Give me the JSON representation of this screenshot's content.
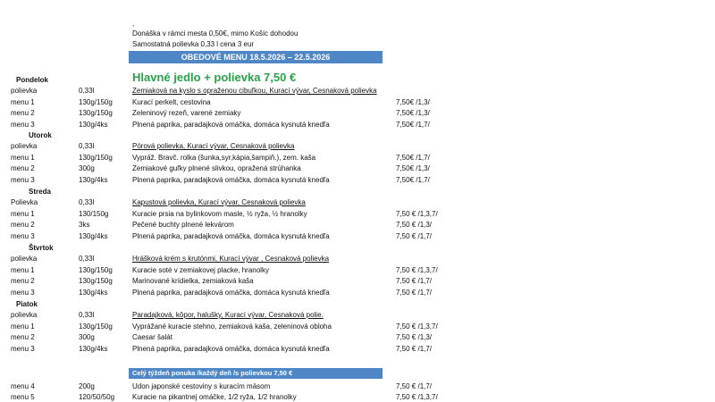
{
  "header": {
    "mark": ",",
    "delivery": "Donáška v rámci mesta 0,50€, mimo Košíc dohodou",
    "soup_note": "Samostatná polievka  0,33 l cena 3 eur",
    "banner": "OBEDOVÉ MENU 18.5.2026 – 22.5.2026",
    "main_title": "Hlavné  jedlo + polievka  7,50 €"
  },
  "days": [
    {
      "name": "Pondelok",
      "rows": [
        {
          "label": "polievka",
          "qty": "0,33l",
          "desc": "Zemiaková na kyslo s opraženou cibuľkou, Kurací vývar,  Cesnaková polievka",
          "price": ""
        },
        {
          "label": " menu 1",
          "qty": "130g/150g",
          "desc": "Kurací perkelt, cestovina",
          "price": "7,50€  /1,3/"
        },
        {
          "label": " menu 2",
          "qty": "130g/150g",
          "desc": "Zeleninový rezeň, varené zemiaky",
          "price": "7,50€  /1,3/"
        },
        {
          "label": " menu 3",
          "qty": "130g/4ks",
          "desc": "Plnená paprika, paradajková omáčka, domáca kysnutá knedľa",
          "price": "7,50€  /1,7/"
        }
      ]
    },
    {
      "name": "Utorok",
      "rows": [
        {
          "label": "polievka",
          "qty": "0,33l",
          "desc": "Pórová polievka,  Kurací vývar,  Cesnaková polievka",
          "price": ""
        },
        {
          "label": "menu 1",
          "qty": "130g/150g",
          "desc": "Vypráž. Bravč. rolka (šunka,syr,kápia,šampiň.), zem. kaša",
          "price": "7,50€  /1,7/"
        },
        {
          "label": "menu 2",
          "qty": "300g",
          "desc": "Zemiakové guľky plnené slivkou, opražená strúhanka",
          "price": "7,50€  /1,3/"
        },
        {
          "label": " menu 3",
          "qty": "130g/4ks",
          "desc": "Plnená paprika, paradajková omáčka, domáca kysnutá knedľa",
          "price": "7,50€  /1,7/"
        }
      ]
    },
    {
      "name": "Streda",
      "rows": [
        {
          "label": "Polievka",
          "qty": "0,33l",
          "desc": "Kapustová  polievka,  Kurací vývar,  Cesnaková polievka",
          "price": ""
        },
        {
          "label": "menu 1",
          "qty": "130/150g",
          "desc": "Kuracie prsia na bylinkovom masle, ½ ryža, ½ hranolky",
          "price": "7,50 €  /1,3,7/"
        },
        {
          "label": "menu 2",
          "qty": "3ks",
          "desc": "Pečené buchty plnené lekvárom",
          "price": "7,50 €  /1,3/"
        },
        {
          "label": "menu 3",
          "qty": "130g/4ks",
          "desc": "Plnená paprika, paradajková omáčka, domáca kysnutá knedľa",
          "price": "7,50 €  /1,7/"
        }
      ]
    },
    {
      "name": "Štvrtok",
      "rows": [
        {
          "label": "polievka",
          "qty": "0,33l",
          "desc": "Hrášková krém s krutónmi, Kurací vývar , Cesnaková polievka",
          "price": ""
        },
        {
          "label": "menu 1",
          "qty": "130g/150g",
          "desc": "Kuracie soté v zemiakovej placke, hranolky",
          "price": "7,50 €  /1,3,7/"
        },
        {
          "label": "menu 2",
          "qty": "130g/150g",
          "desc": "Marinované krídielka, zemiaková kaša",
          "price": "7,50 €  /1,7/"
        },
        {
          "label": "menu 3",
          "qty": "130g/4ks",
          "desc": "Plnená paprika, paradajková omáčka, domáca kysnutá knedľa",
          "price": "7,50 €  /1,7/"
        }
      ]
    },
    {
      "name": "Piatok",
      "rows": [
        {
          "label": "polievka",
          "qty": "0,33l",
          "desc": "Paradajková, kôpor, halušky,  Kurací vývar,  Cesnaková  polie.",
          "price": ""
        },
        {
          "label": "menu 1",
          "qty": "130g/150g",
          "desc": "Vyprážané kuracie stehno, zemiaková kaša, zeleninová obloha",
          "price": "7,50 €  /1,3,7/"
        },
        {
          "label": "menu 2",
          "qty": "300g",
          "desc": "Caesar šalát",
          "price": "7,50 €  /1,3/"
        },
        {
          "label": "menu 3",
          "qty": "130g/4ks",
          "desc": "Plnená paprika, paradajková omáčka, domáca kysnutá knedľa",
          "price": "7,50 €  /1,7/"
        }
      ]
    }
  ],
  "week_banner": "Celý týždeň ponuka /každý deň /s polievkou 7,50 €",
  "week_rows": [
    {
      "label": " menu 4",
      "qty": "200g",
      "desc": "Udon japonské cestoviny s kuracím mäsom",
      "price": "7,50 €  /1,7/"
    },
    {
      "label": " menu 5",
      "qty": "120/50/50g",
      "desc": "Kuracie na pikantnej omáčke, 1/2 ryža, 1/2 hranolky",
      "price": "7,50 €  /1,3,7/"
    }
  ],
  "colors": {
    "banner": "#4f86c6",
    "title_green": "#2aa24a",
    "text": "#111111"
  }
}
